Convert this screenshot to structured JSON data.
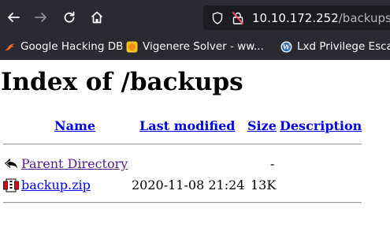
{
  "browser": {
    "url_host": "10.10.172.252",
    "url_path": "/backups/",
    "bookmarks": [
      {
        "label": "Google Hacking DB",
        "icon": "exploit-db-icon"
      },
      {
        "label": "Vigenere Solver - ww...",
        "icon": "orange-circle-icon"
      },
      {
        "label": "Lxd Privilege Escal",
        "icon": "wordpress-icon"
      }
    ]
  },
  "page": {
    "title": "Index of /backups",
    "columns": {
      "name": "Name",
      "last_modified": "Last modified",
      "size": "Size",
      "description": "Description"
    },
    "rows": [
      {
        "name": "Parent Directory",
        "last_modified": "",
        "size": "-",
        "description": "",
        "icon": "back-arrow-icon"
      },
      {
        "name": "backup.zip",
        "last_modified": "2020-11-08 21:24",
        "size": "13K",
        "description": "",
        "icon": "compressed-file-icon"
      }
    ]
  }
}
